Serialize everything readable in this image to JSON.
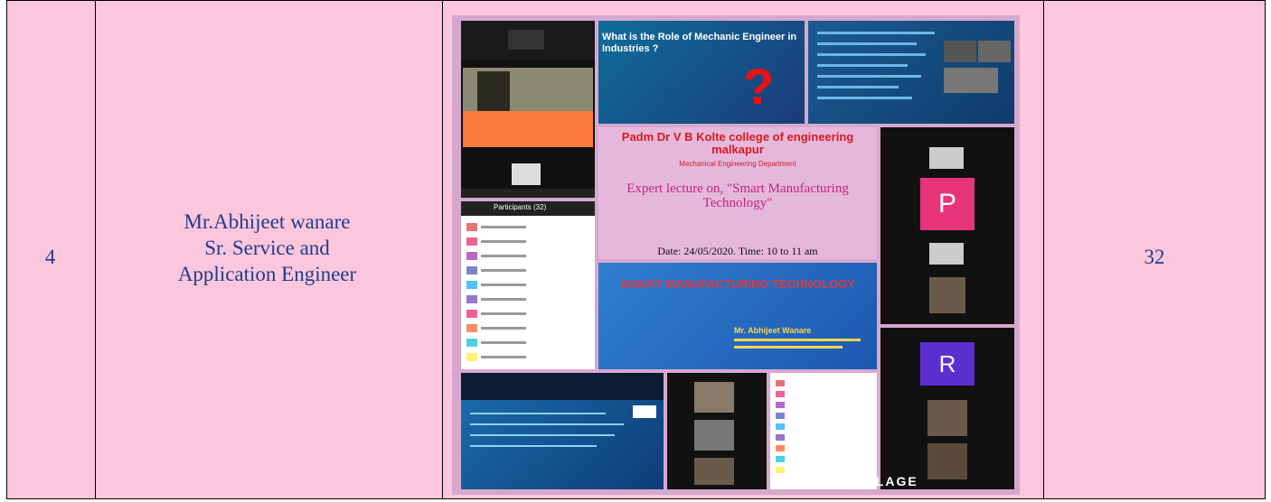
{
  "row": {
    "serial": "4",
    "speaker_name": "Mr.Abhijeet wanare",
    "speaker_role_line1": "Sr. Service and",
    "speaker_role_line2": "Application Engineer",
    "count": "32"
  },
  "collage": {
    "slide_title": "What is the Role of Mechanic Engineer in Industries ?",
    "question_mark": "?",
    "poster_college": "Padm Dr V B Kolte college of engineering malkapur",
    "poster_dept": "Mechanical Engineering Department",
    "poster_lecture": "Expert lecture on, \"Smart Manufacturing Technology\"",
    "poster_date": "Date: 24/05/2020.  Time: 10 to 11 am",
    "slide2_title": "SMART MANUFACTURING TECHNOLOGY",
    "slide2_speaker": "Mr. Abhijeet Wanare",
    "participants_header": "Participants (32)",
    "tile_letter_p": "P",
    "tile_letter_r": "R",
    "watermark": "PIC COLLAGE",
    "colors": {
      "p_tile": "#e8357a",
      "r_tile": "#5b2fd0",
      "zoom_orange": "#ff7a3d"
    }
  }
}
